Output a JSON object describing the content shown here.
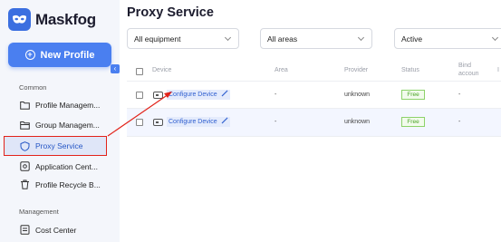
{
  "app": {
    "name": "Maskfog",
    "brand_color": "#3b6fe0",
    "highlight_color": "#e2231a"
  },
  "sidebar": {
    "new_profile_label": "New Profile",
    "collapse_glyph": "‹",
    "sections": [
      {
        "label": "Common"
      },
      {
        "label": "Management"
      }
    ],
    "items": [
      {
        "label": "Profile Managem...",
        "icon": "folder-icon"
      },
      {
        "label": "Group Managem...",
        "icon": "group-folder-icon"
      },
      {
        "label": "Proxy Service",
        "icon": "shield-icon",
        "active": true
      },
      {
        "label": "Application Cent...",
        "icon": "app-center-icon"
      },
      {
        "label": "Profile Recycle B...",
        "icon": "trash-icon"
      },
      {
        "label": "Cost Center",
        "icon": "cost-icon"
      }
    ]
  },
  "main": {
    "title": "Proxy Service",
    "filters": [
      {
        "value": "All equipment"
      },
      {
        "value": "All areas"
      },
      {
        "value": "Active"
      }
    ],
    "columns": [
      "Device",
      "Area",
      "Provider",
      "Status",
      "Bind",
      "accoun",
      "I"
    ],
    "rows": [
      {
        "device": "Configure Device",
        "area": "-",
        "provider": "unknown",
        "status": "Free",
        "bind": "-"
      },
      {
        "device": "Configure Device",
        "area": "-",
        "provider": "unknown",
        "status": "Free",
        "bind": "-"
      }
    ]
  }
}
